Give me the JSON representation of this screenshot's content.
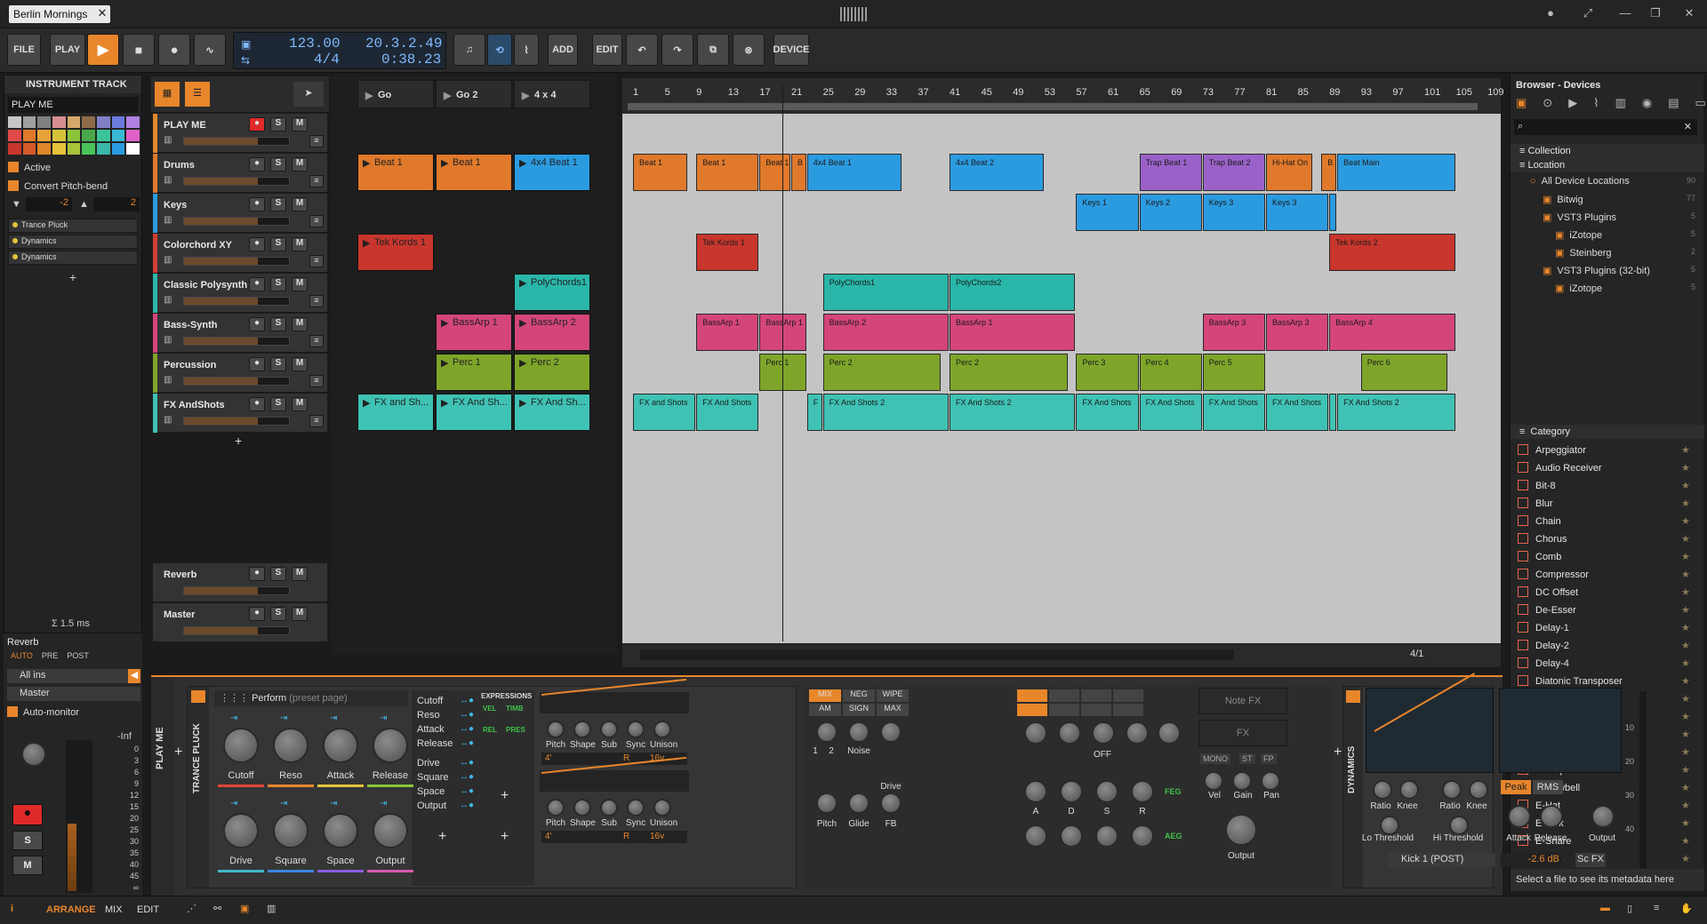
{
  "window": {
    "project_tab": "Berlin Mornings"
  },
  "toolbar": {
    "file": "FILE",
    "play_mode": "PLAY",
    "add": "ADD",
    "edit": "EDIT",
    "device": "DEVICE",
    "tempo": "123.00",
    "time_sig": "4/4",
    "position": "20.3.2.49",
    "time": "0:38.23"
  },
  "inspector": {
    "title": "INSTRUMENT TRACK",
    "track_name": "PLAY ME",
    "active": "Active",
    "convert": "Convert Pitch-bend",
    "pb_down": "-2",
    "pb_up": "2",
    "devices": [
      "Trance Pluck",
      "Dynamics",
      "Dynamics"
    ],
    "latency": "Σ 1.5 ms",
    "send": "Reverb",
    "send_modes": [
      "AUTO",
      "PRE",
      "POST"
    ],
    "input": "All ins",
    "output": "Master",
    "monitor": "Auto-monitor",
    "meter_top": "-Inf",
    "meter_scale": [
      "0",
      "3",
      "6",
      "9",
      "12",
      "15",
      "20",
      "25",
      "30",
      "35",
      "40",
      "45",
      "∞"
    ]
  },
  "tracks": [
    {
      "name": "PLAY ME",
      "color": "#e08a2c"
    },
    {
      "name": "Drums",
      "color": "#e0792c"
    },
    {
      "name": "Keys",
      "color": "#2b9be0"
    },
    {
      "name": "Colorchord XY",
      "color": "#d23e34"
    },
    {
      "name": "Classic Polysynth",
      "color": "#2ab7a9"
    },
    {
      "name": "Bass-Synth",
      "color": "#d4457a"
    },
    {
      "name": "Percussion",
      "color": "#7ea52a"
    },
    {
      "name": "FX AndShots",
      "color": "#3fc2b4"
    }
  ],
  "fx_tracks": [
    {
      "name": "Reverb"
    },
    {
      "name": "Master"
    }
  ],
  "scenes": [
    "Go",
    "Go 2",
    "4 x 4"
  ],
  "launcher_clips": [
    {
      "row": 1,
      "col": 0,
      "label": "Beat 1",
      "color": "#e0792c"
    },
    {
      "row": 1,
      "col": 1,
      "label": "Beat 1",
      "color": "#e0792c"
    },
    {
      "row": 1,
      "col": 2,
      "label": "4x4 Beat 1",
      "color": "#2b9be0"
    },
    {
      "row": 3,
      "col": 0,
      "label": "Tek Kords 1",
      "color": "#c8362d"
    },
    {
      "row": 4,
      "col": 2,
      "label": "PolyChords1",
      "color": "#2ab7a9"
    },
    {
      "row": 5,
      "col": 1,
      "label": "BassArp 1",
      "color": "#d4457a"
    },
    {
      "row": 5,
      "col": 2,
      "label": "BassArp 2",
      "color": "#d4457a"
    },
    {
      "row": 6,
      "col": 1,
      "label": "Perc 1",
      "color": "#7ea52a"
    },
    {
      "row": 6,
      "col": 2,
      "label": "Perc 2",
      "color": "#7ea52a"
    },
    {
      "row": 7,
      "col": 0,
      "label": "FX and Sh...",
      "color": "#3fc2b4"
    },
    {
      "row": 7,
      "col": 1,
      "label": "FX And Sh...",
      "color": "#3fc2b4"
    },
    {
      "row": 7,
      "col": 2,
      "label": "FX And Sh...",
      "color": "#3fc2b4"
    }
  ],
  "ruler": [
    "1",
    "5",
    "9",
    "13",
    "17",
    "21",
    "25",
    "29",
    "33",
    "37",
    "41",
    "45",
    "49",
    "53",
    "57",
    "61",
    "65",
    "69",
    "73",
    "77",
    "81",
    "85",
    "89",
    "93",
    "97",
    "101",
    "105",
    "109"
  ],
  "arrange_clips": [
    {
      "row": 1,
      "start": 1,
      "len": 7,
      "label": "Beat 1",
      "color": "#e0792c"
    },
    {
      "row": 1,
      "start": 9,
      "len": 8,
      "label": "Beat 1",
      "color": "#e0792c"
    },
    {
      "row": 1,
      "start": 17,
      "len": 4,
      "label": "Beat 1",
      "color": "#e0792c"
    },
    {
      "row": 1,
      "start": 21,
      "len": 2,
      "label": "B",
      "color": "#e0792c"
    },
    {
      "row": 1,
      "start": 23,
      "len": 12,
      "label": "4x4 Beat 1",
      "color": "#2b9be0"
    },
    {
      "row": 1,
      "start": 41,
      "len": 12,
      "label": "4x4 Beat 2",
      "color": "#2b9be0"
    },
    {
      "row": 1,
      "start": 65,
      "len": 8,
      "label": "Trap Beat 1",
      "color": "#9a62c9"
    },
    {
      "row": 1,
      "start": 73,
      "len": 8,
      "label": "Trap Beat 2",
      "color": "#9a62c9"
    },
    {
      "row": 1,
      "start": 81,
      "len": 6,
      "label": "Hi-Hat On",
      "color": "#e0792c"
    },
    {
      "row": 1,
      "start": 88,
      "len": 2,
      "label": "B",
      "color": "#e0792c"
    },
    {
      "row": 1,
      "start": 90,
      "len": 15,
      "label": "Beat Main",
      "color": "#2b9be0"
    },
    {
      "row": 2,
      "start": 57,
      "len": 8,
      "label": "Keys 1",
      "color": "#2b9be0"
    },
    {
      "row": 2,
      "start": 65,
      "len": 8,
      "label": "Keys 2",
      "color": "#2b9be0"
    },
    {
      "row": 2,
      "start": 73,
      "len": 8,
      "label": "Keys 3",
      "color": "#2b9be0"
    },
    {
      "row": 2,
      "start": 81,
      "len": 8,
      "label": "Keys 3",
      "color": "#2b9be0"
    },
    {
      "row": 2,
      "start": 89,
      "len": 1,
      "label": "B",
      "color": "#2b9be0"
    },
    {
      "row": 3,
      "start": 9,
      "len": 8,
      "label": "Tek Kords 1",
      "color": "#c8362d"
    },
    {
      "row": 3,
      "start": 89,
      "len": 16,
      "label": "Tek Kords 2",
      "color": "#c8362d"
    },
    {
      "row": 4,
      "start": 25,
      "len": 16,
      "label": "PolyChords1",
      "color": "#2ab7a9"
    },
    {
      "row": 4,
      "start": 41,
      "len": 16,
      "label": "PolyChords2",
      "color": "#2ab7a9"
    },
    {
      "row": 5,
      "start": 9,
      "len": 8,
      "label": "BassArp 1",
      "color": "#d4457a"
    },
    {
      "row": 5,
      "start": 17,
      "len": 6,
      "label": "BassArp 1",
      "color": "#d4457a"
    },
    {
      "row": 5,
      "start": 25,
      "len": 16,
      "label": "BassArp 2",
      "color": "#d4457a"
    },
    {
      "row": 5,
      "start": 41,
      "len": 16,
      "label": "BassArp 1",
      "color": "#d4457a"
    },
    {
      "row": 5,
      "start": 73,
      "len": 8,
      "label": "BassArp 3",
      "color": "#d4457a"
    },
    {
      "row": 5,
      "start": 81,
      "len": 8,
      "label": "BassArp 3",
      "color": "#d4457a"
    },
    {
      "row": 5,
      "start": 89,
      "len": 16,
      "label": "BassArp 4",
      "color": "#d4457a"
    },
    {
      "row": 6,
      "start": 17,
      "len": 6,
      "label": "Perc 1",
      "color": "#7ea52a"
    },
    {
      "row": 6,
      "start": 25,
      "len": 15,
      "label": "Perc 2",
      "color": "#7ea52a"
    },
    {
      "row": 6,
      "start": 41,
      "len": 15,
      "label": "Perc 2",
      "color": "#7ea52a"
    },
    {
      "row": 6,
      "start": 57,
      "len": 8,
      "label": "Perc 3",
      "color": "#7ea52a"
    },
    {
      "row": 6,
      "start": 65,
      "len": 8,
      "label": "Perc 4",
      "color": "#7ea52a"
    },
    {
      "row": 6,
      "start": 73,
      "len": 8,
      "label": "Perc 5",
      "color": "#7ea52a"
    },
    {
      "row": 6,
      "start": 93,
      "len": 11,
      "label": "Perc 6",
      "color": "#7ea52a"
    },
    {
      "row": 7,
      "start": 1,
      "len": 8,
      "label": "FX and Shots",
      "color": "#3fc2b4"
    },
    {
      "row": 7,
      "start": 9,
      "len": 8,
      "label": "FX And Shots",
      "color": "#3fc2b4"
    },
    {
      "row": 7,
      "start": 23,
      "len": 2,
      "label": "F",
      "color": "#3fc2b4"
    },
    {
      "row": 7,
      "start": 25,
      "len": 16,
      "label": "FX And Shots 2",
      "color": "#3fc2b4"
    },
    {
      "row": 7,
      "start": 41,
      "len": 16,
      "label": "FX And Shots 2",
      "color": "#3fc2b4"
    },
    {
      "row": 7,
      "start": 57,
      "len": 8,
      "label": "FX And Shots",
      "color": "#3fc2b4"
    },
    {
      "row": 7,
      "start": 65,
      "len": 8,
      "label": "FX And Shots",
      "color": "#3fc2b4"
    },
    {
      "row": 7,
      "start": 73,
      "len": 8,
      "label": "FX And Shots",
      "color": "#3fc2b4"
    },
    {
      "row": 7,
      "start": 81,
      "len": 8,
      "label": "FX And Shots",
      "color": "#3fc2b4"
    },
    {
      "row": 7,
      "start": 89,
      "len": 1,
      "label": "F",
      "color": "#3fc2b4"
    },
    {
      "row": 7,
      "start": 90,
      "len": 15,
      "label": "FX And Shots 2",
      "color": "#3fc2b4"
    }
  ],
  "arrange_zoom": "4/1",
  "browser": {
    "title": "Browser - Devices",
    "sections": [
      "Collection",
      "Location"
    ],
    "locations": [
      {
        "label": "All Device Locations",
        "count": "90",
        "indent": 0
      },
      {
        "label": "Bitwig",
        "count": "77",
        "indent": 1
      },
      {
        "label": "VST3 Plugins",
        "count": "5",
        "indent": 1
      },
      {
        "label": "iZotope",
        "count": "5",
        "indent": 2
      },
      {
        "label": "Steinberg",
        "count": "2",
        "indent": 2
      },
      {
        "label": "VST3 Plugins (32-bit)",
        "count": "5",
        "indent": 1
      },
      {
        "label": "iZotope",
        "count": "5",
        "indent": 2
      }
    ],
    "category_title": "Category",
    "categories": [
      "Arpeggiator",
      "Audio Receiver",
      "Bit-8",
      "Blur",
      "Chain",
      "Chorus",
      "Comb",
      "Compressor",
      "DC Offset",
      "De-Esser",
      "Delay-1",
      "Delay-2",
      "Delay-4",
      "Diatonic Transposer",
      "Distortion",
      "Drum Machine",
      "Dual Pan",
      "Dynamics",
      "E-Clap",
      "E-Cowbell",
      "E-Hat",
      "E-Kick",
      "E-Snare",
      "E-Tom"
    ],
    "footer": "Select a file to see its metadata here"
  },
  "device": {
    "track_label": "PLAY ME",
    "device_name": "TRANCE PLUCK",
    "preset": "Perform",
    "preset_hint": "(preset page)",
    "macros": [
      "Cutoff",
      "Reso",
      "Attack",
      "Release",
      "Drive",
      "Square",
      "Space",
      "Output"
    ],
    "macro_colors": [
      "#e0463c",
      "#e8862b",
      "#e3c43a",
      "#8bc43a",
      "#3fb8c8",
      "#3b86e0",
      "#8b5ee0",
      "#d85ab0"
    ],
    "mod_targets": [
      "Cutoff",
      "Reso",
      "Attack",
      "Release",
      "Drive",
      "Square",
      "Space",
      "Output"
    ],
    "expressions": [
      "EXPRESSIONS",
      "VEL",
      "TIMB",
      "REL",
      "PRES"
    ],
    "osc_labels": [
      "Pitch",
      "Shape",
      "Sub",
      "Sync",
      "Unison"
    ],
    "osc1_values": [
      "4'",
      "R",
      "16v"
    ],
    "osc2_values": [
      "4'",
      "R",
      "16v"
    ],
    "mix_buttons": [
      "MIX",
      "NEG",
      "WIPE",
      "AM",
      "SIGN",
      "MAX"
    ],
    "noise_labels": [
      "1",
      "2",
      "Noise",
      "Drive",
      "Pitch",
      "Glide",
      "FB"
    ],
    "filter_labels": [
      "OFF"
    ],
    "env_labels": [
      "A",
      "D",
      "S",
      "R",
      "FEG",
      "AEG"
    ],
    "note_fx": "Note FX",
    "fx": "FX",
    "output_modes": [
      "MONO",
      "ST",
      "FP"
    ],
    "out_labels": [
      "Vel",
      "Gain",
      "Pan",
      "Output"
    ],
    "dyn_name": "DYNAMICS",
    "dyn_labels": [
      "Ratio",
      "Knee",
      "Ratio",
      "Knee",
      "Lo Threshold",
      "Hi Threshold",
      "Attack",
      "Release",
      "Output"
    ],
    "dyn_modes": [
      "Peak",
      "RMS"
    ],
    "sidechain": "Kick 1 (POST)",
    "sc_value": "-2.6 dB",
    "sc_fx": "Sc FX",
    "dyn_scale": [
      "10",
      "20",
      "30",
      "40"
    ]
  },
  "bottom": {
    "tabs": [
      "ARRANGE",
      "MIX",
      "EDIT"
    ]
  }
}
